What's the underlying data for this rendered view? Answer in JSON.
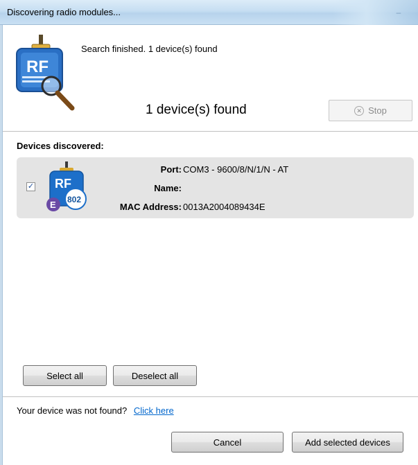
{
  "window": {
    "title": "Discovering radio modules..."
  },
  "header": {
    "status_message": "Search finished. 1 device(s) found",
    "found_count": "1 device(s) found",
    "stop_label": "Stop",
    "icon_text": "RF"
  },
  "devices": {
    "section_title": "Devices discovered:",
    "items": [
      {
        "checked": true,
        "icon_text": "RF",
        "icon_badge": "802",
        "icon_letter": "E",
        "port_label": "Port:",
        "port_value": "COM3 - 9600/8/N/1/N - AT",
        "name_label": "Name:",
        "name_value": "",
        "mac_label": "MAC Address:",
        "mac_value": "0013A2004089434E"
      }
    ]
  },
  "selection": {
    "select_all_label": "Select all",
    "deselect_all_label": "Deselect all"
  },
  "footer": {
    "not_found_text": "Your device was not found?",
    "click_here_label": "Click here",
    "cancel_label": "Cancel",
    "add_label": "Add selected devices"
  },
  "colors": {
    "link": "#0066cc",
    "card_bg": "#e4e4e4",
    "icon_blue": "#1d6fc9",
    "icon_purple": "#6a4aa5"
  }
}
